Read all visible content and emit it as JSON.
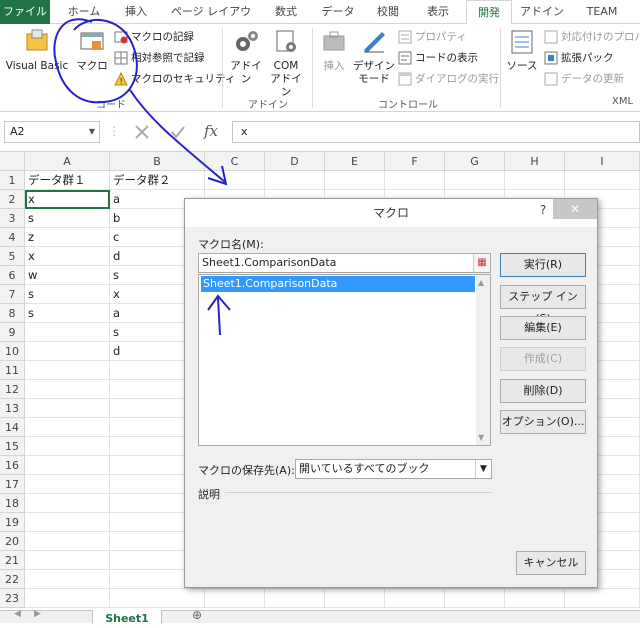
{
  "ribbon_tabs": [
    "ファイル",
    "ホーム",
    "挿入",
    "ページ レイアウト",
    "数式",
    "データ",
    "校閲",
    "表示",
    "開発",
    "アドイン",
    "TEAM"
  ],
  "ribbon": {
    "code_group": {
      "label": "コード",
      "visual_basic": "Visual Basic",
      "macro": "マクロ",
      "record": "マクロの記録",
      "relative": "相対参照で記録",
      "security": "マクロのセキュリティ"
    },
    "addin_group": {
      "label": "アドイン",
      "addin": "アドイン",
      "com_addin_1": "COM",
      "com_addin_2": "アドイン"
    },
    "control_group": {
      "label": "コントロール",
      "insert": "挿入",
      "design_1": "デザイン",
      "design_2": "モード",
      "properties": "プロパティ",
      "view_code": "コードの表示",
      "run_dialog": "ダイアログの実行"
    },
    "xml_group": {
      "label": "XML",
      "source": "ソース",
      "map_props": "対応付けのプロパ",
      "expansion": "拡張パック",
      "refresh": "データの更新"
    }
  },
  "formula_bar": {
    "name_box": "A2",
    "fx": "fx",
    "value": "x"
  },
  "grid": {
    "columns": [
      "A",
      "B",
      "C",
      "D",
      "E",
      "F",
      "G",
      "H",
      "I"
    ],
    "rows": [
      "1",
      "2",
      "3",
      "4",
      "5",
      "6",
      "7",
      "8",
      "9",
      "10",
      "11",
      "12",
      "13",
      "14",
      "15",
      "16",
      "17",
      "18",
      "19",
      "20",
      "21",
      "22",
      "23"
    ],
    "colA": [
      "データ群１",
      "x",
      "s",
      "z",
      "x",
      "w",
      "s",
      "s",
      "",
      ""
    ],
    "colB": [
      "データ群２",
      "a",
      "b",
      "c",
      "d",
      "s",
      "x",
      "a",
      "s",
      "d"
    ]
  },
  "sheet_tab": "Sheet1",
  "dialog": {
    "title": "マクロ",
    "help": "?",
    "close": "✕",
    "macro_name_label": "マクロ名(M):",
    "macro_name_value": "Sheet1.ComparisonData",
    "list_items": [
      "Sheet1.ComparisonData"
    ],
    "buttons": [
      "実行(R)",
      "ステップ イン(S)",
      "編集(E)",
      "作成(C)",
      "削除(D)",
      "オプション(O)..."
    ],
    "save_label": "マクロの保存先(A):",
    "save_value": "開いているすべてのブック",
    "description_label": "説明",
    "cancel": "キャンセル"
  },
  "colors": {
    "excel_green": "#217346",
    "selection": "#3399ff",
    "annotation": "#2323c8"
  }
}
